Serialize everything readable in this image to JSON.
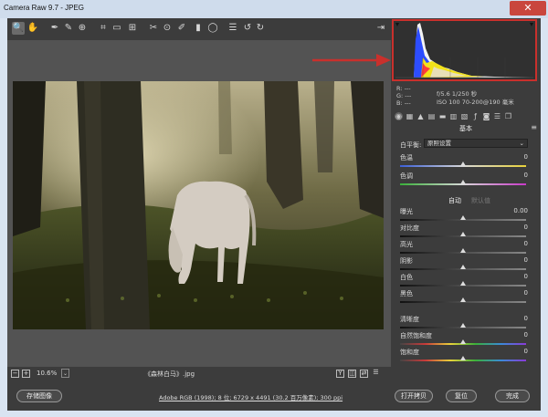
{
  "window": {
    "title": "Camera Raw 9.7 - JPEG",
    "close_glyph": "✕"
  },
  "toolbar": {
    "tools": [
      {
        "name": "zoom-tool-icon",
        "glyph": "🔍"
      },
      {
        "name": "hand-tool-icon",
        "glyph": "✋"
      },
      {
        "name": "white-balance-tool-icon",
        "glyph": "✒"
      },
      {
        "name": "color-sampler-tool-icon",
        "glyph": "✎"
      },
      {
        "name": "targeted-adjustment-tool-icon",
        "glyph": "⊕"
      },
      {
        "name": "crop-tool-icon",
        "glyph": "⌗"
      },
      {
        "name": "straighten-tool-icon",
        "glyph": "▭"
      },
      {
        "name": "transform-tool-icon",
        "glyph": "⊞"
      },
      {
        "name": "spot-removal-tool-icon",
        "glyph": "✂"
      },
      {
        "name": "red-eye-tool-icon",
        "glyph": "⊙"
      },
      {
        "name": "adjustment-brush-icon",
        "glyph": "✐"
      },
      {
        "name": "graduated-filter-icon",
        "glyph": "▮"
      },
      {
        "name": "radial-filter-icon",
        "glyph": "◯"
      },
      {
        "name": "preferences-icon",
        "glyph": "☰"
      },
      {
        "name": "rotate-left-icon",
        "glyph": "↺"
      },
      {
        "name": "rotate-right-icon",
        "glyph": "↻"
      }
    ],
    "fullscreen_glyph": "⇥"
  },
  "histogram": {
    "rgb_r": "R:  ---",
    "rgb_g": "G:  ---",
    "rgb_b": "B:  ---",
    "exposure": "f/5.6   1/250 秒",
    "iso_lens": "ISO 100   70-200@190 毫米"
  },
  "panel": {
    "section_title": "基本",
    "wb_label": "白平衡:",
    "wb_value": "原照设置",
    "wb_caret": "⌄",
    "auto": "自动",
    "default": "默认值",
    "menu_glyph": "≡",
    "adjustments": [
      {
        "label": "色温",
        "value": "0",
        "pos": 0.5,
        "kind": "temp"
      },
      {
        "label": "色调",
        "value": "0",
        "pos": 0.5,
        "kind": "tint"
      },
      {
        "label": "曝光",
        "value": "0.00",
        "pos": 0.5,
        "kind": "gray"
      },
      {
        "label": "对比度",
        "value": "0",
        "pos": 0.5,
        "kind": "gray"
      },
      {
        "label": "高光",
        "value": "0",
        "pos": 0.5,
        "kind": "gray"
      },
      {
        "label": "阴影",
        "value": "0",
        "pos": 0.5,
        "kind": "gray"
      },
      {
        "label": "白色",
        "value": "0",
        "pos": 0.5,
        "kind": "gray"
      },
      {
        "label": "黑色",
        "value": "0",
        "pos": 0.5,
        "kind": "gray"
      },
      {
        "label": "清晰度",
        "value": "0",
        "pos": 0.5,
        "kind": "gray"
      },
      {
        "label": "自然饱和度",
        "value": "0",
        "pos": 0.5,
        "kind": "rainbow"
      },
      {
        "label": "饱和度",
        "value": "0",
        "pos": 0.5,
        "kind": "rainbow"
      }
    ]
  },
  "bottombar": {
    "minus": "−",
    "plus": "+",
    "zoom_value": "10.6%",
    "zoom_caret": "⌄",
    "filename": "《森林白马》.jpg",
    "view_y": "Y",
    "view_before_after": "◫",
    "view_swap": "⇄",
    "view_settings": "☰"
  },
  "footer": {
    "save_label": "存储图像",
    "workflow_link": "Adobe RGB (1998); 8 位; 6729 x 4491 (30.2 百万像素); 300 ppi",
    "open_copy_label": "打开拷贝",
    "reset_label": "复位",
    "done_label": "完成"
  },
  "colors": {
    "highlight_box": "#c9302c",
    "arrow": "#c9302c"
  }
}
